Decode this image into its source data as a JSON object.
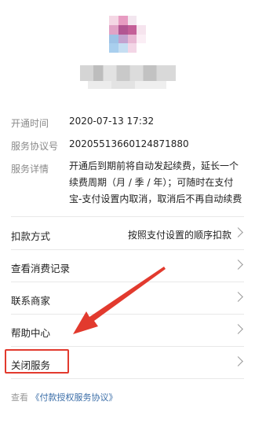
{
  "info": {
    "open_time_label": "开通时间",
    "open_time_value": "2020-07-13 17:32",
    "agreement_no_label": "服务协议号",
    "agreement_no_value": "20205513660124871880",
    "details_label": "服务详情",
    "details_line1": "开通后到期前将自动发起续费，延长一个",
    "details_line2": "续费周期（月 / 季 / 年）；可随时在支付",
    "details_line3": "宝-支付设置内取消，取消后不再自动续费"
  },
  "menu": {
    "deduction_label": "扣款方式",
    "deduction_value": "按照支付设置的顺序扣款",
    "consumption_label": "查看消费记录",
    "contact_label": "联系商家",
    "help_label": "帮助中心",
    "close_label": "关闭服务"
  },
  "footer": {
    "prefix": "查看",
    "link": "《付款授权服务协议》"
  },
  "colors": {
    "annotation_red": "#e23a2e",
    "link_blue": "#3b6ea8"
  }
}
